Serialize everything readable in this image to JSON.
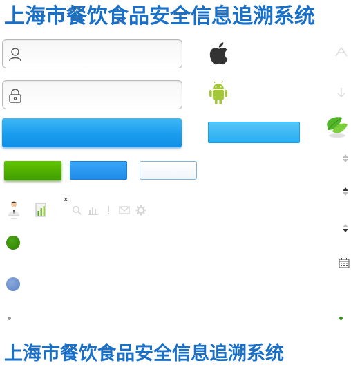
{
  "header": {
    "title": "上海市餐饮食品安全信息追溯系统"
  },
  "footer": {
    "title": "上海市餐饮食品安全信息追溯系统"
  },
  "login": {
    "username": {
      "value": "",
      "placeholder": ""
    },
    "password": {
      "value": "",
      "placeholder": ""
    }
  },
  "buttons": {
    "primary_large": "",
    "primary_medium": "",
    "green": "",
    "blue": "",
    "white": ""
  },
  "misc": {
    "close_glyph": "×"
  },
  "colors": {
    "title": "#1a6fc6",
    "primary_blue": "#1a9cee",
    "green": "#3f9c00",
    "android_green": "#a4c639",
    "apple_dark": "#333333"
  },
  "icons": [
    "user-icon",
    "lock-icon",
    "apple-icon",
    "android-icon",
    "leaf-icon",
    "font-icon",
    "arrow-down-icon",
    "sort-updown-icon",
    "sort-up-icon",
    "sort-down-icon",
    "calendar-icon",
    "person-avatar-icon",
    "bar-chart-doc-icon",
    "close-icon",
    "search-icon",
    "stats-icon",
    "alert-icon",
    "mail-icon",
    "gear-icon"
  ]
}
